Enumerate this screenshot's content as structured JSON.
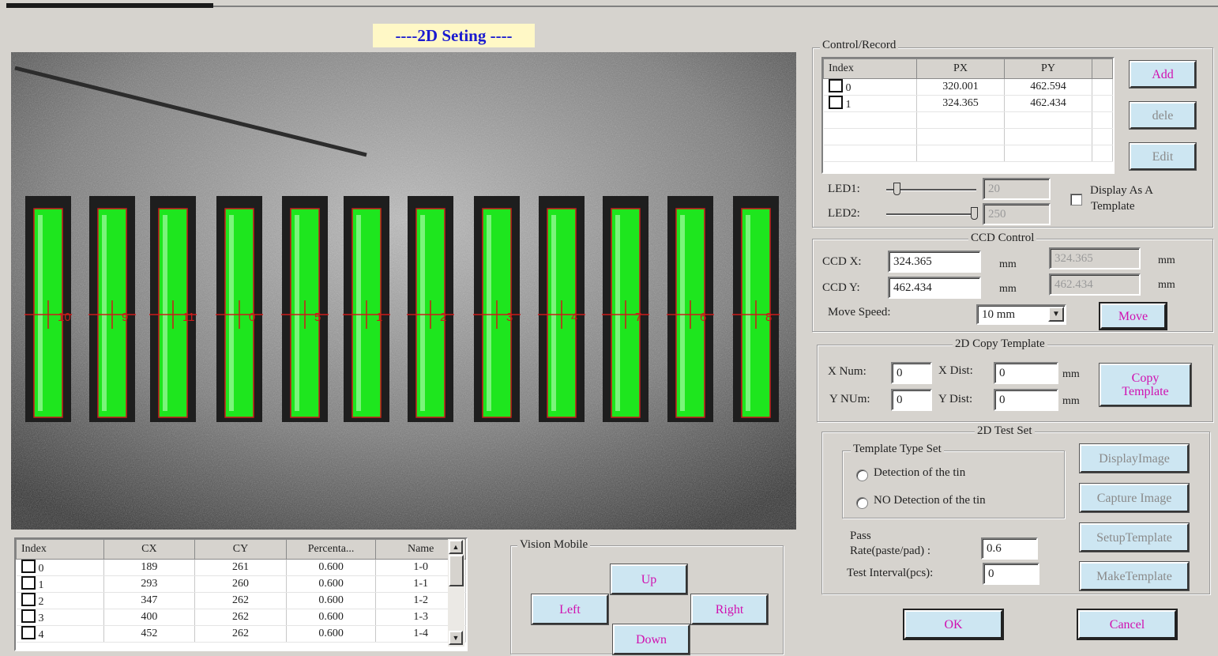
{
  "title": "----2D Seting ----",
  "camera": {
    "pad_labels": [
      "10",
      "9",
      "11",
      "0",
      "5",
      "1",
      "2",
      "3",
      "4",
      "7",
      "6",
      "8"
    ]
  },
  "control_record": {
    "legend": "Control/Record",
    "columns": [
      "Index",
      "PX",
      "PY"
    ],
    "rows": [
      {
        "index": "0",
        "px": "320.001",
        "py": "462.594"
      },
      {
        "index": "1",
        "px": "324.365",
        "py": "462.434"
      }
    ],
    "add_label": "Add",
    "dele_label": "dele",
    "edit_label": "Edit",
    "led1_label": "LED1:",
    "led1_value": "20",
    "led1_level": 0.08,
    "led2_label": "LED2:",
    "led2_value": "250",
    "led2_level": 1.0,
    "display_template_label_1": "Display As A",
    "display_template_label_2": "Template"
  },
  "ccd_control": {
    "legend": "CCD Control",
    "ccd_x_label": "CCD X:",
    "ccd_x_value": "324.365",
    "ccd_x_readout": "324.365",
    "ccd_y_label": "CCD Y:",
    "ccd_y_value": "462.434",
    "ccd_y_readout": "462.434",
    "unit": "mm",
    "move_speed_label": "Move  Speed:",
    "move_speed_value": "10 mm",
    "move_label": "Move"
  },
  "copy_template": {
    "legend": "2D Copy Template",
    "x_num_label": "X  Num:",
    "x_num_value": "0",
    "y_num_label": "Y NUm:",
    "y_num_value": "0",
    "x_dist_label": "X Dist:",
    "x_dist_value": "0",
    "y_dist_label": "Y Dist:",
    "y_dist_value": "0",
    "unit": "mm",
    "copy_label_1": "Copy",
    "copy_label_2": "Template"
  },
  "test_set": {
    "legend": "2D Test Set",
    "type_legend": "Template Type Set",
    "option1": "Detection of the tin",
    "option2": "NO Detection of the tin",
    "pass_rate_label_1": "Pass",
    "pass_rate_label_2": "Rate(paste/pad) :",
    "pass_rate_value": "0.6",
    "test_interval_label": "Test Interval(pcs):",
    "test_interval_value": "0",
    "display_image_label": "DisplayImage",
    "capture_image_label": "Capture Image",
    "setup_template_label": "SetupTemplate",
    "make_template_label": "MakeTemplate"
  },
  "result_table": {
    "columns": [
      "Index",
      "CX",
      "CY",
      "Percenta...",
      "Name"
    ],
    "rows": [
      {
        "index": "0",
        "cx": "189",
        "cy": "261",
        "pct": "0.600",
        "name": "1-0"
      },
      {
        "index": "1",
        "cx": "293",
        "cy": "260",
        "pct": "0.600",
        "name": "1-1"
      },
      {
        "index": "2",
        "cx": "347",
        "cy": "262",
        "pct": "0.600",
        "name": "1-2"
      },
      {
        "index": "3",
        "cx": "400",
        "cy": "262",
        "pct": "0.600",
        "name": "1-3"
      },
      {
        "index": "4",
        "cx": "452",
        "cy": "262",
        "pct": "0.600",
        "name": "1-4"
      }
    ]
  },
  "vision_mobile": {
    "legend": "Vision Mobile",
    "up": "Up",
    "left": "Left",
    "right": "Right",
    "down": "Down"
  },
  "footer": {
    "ok": "OK",
    "cancel": "Cancel"
  }
}
